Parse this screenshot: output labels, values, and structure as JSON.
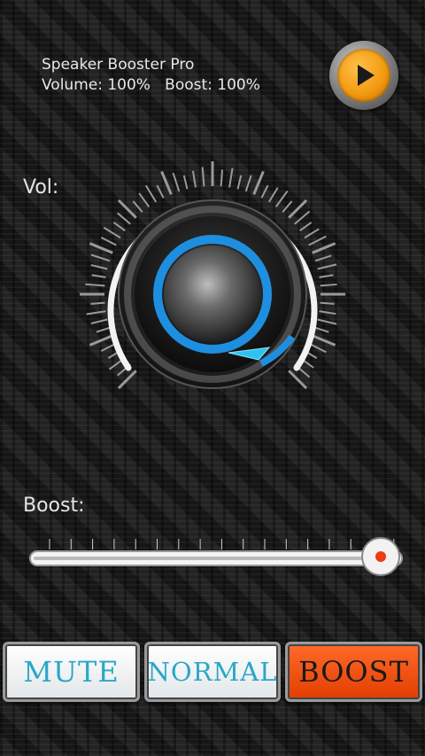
{
  "header": {
    "app_title": "Speaker Booster Pro",
    "status_line": "Volume: 100%   Boost: 100%"
  },
  "volume": {
    "label": "Vol:",
    "level_percent": 100
  },
  "boost": {
    "label": "Boost:",
    "level_percent": 100
  },
  "buttons": {
    "mute": "MUTE",
    "normal": "NORMAL",
    "boost": "BOOST"
  },
  "colors": {
    "accent_blue": "#1e8fe0",
    "play_orange": "#f39b12",
    "boost_red": "#e84a10",
    "button_text_cyan": "#2aa7c7"
  },
  "icons": {
    "play": "play-icon"
  }
}
